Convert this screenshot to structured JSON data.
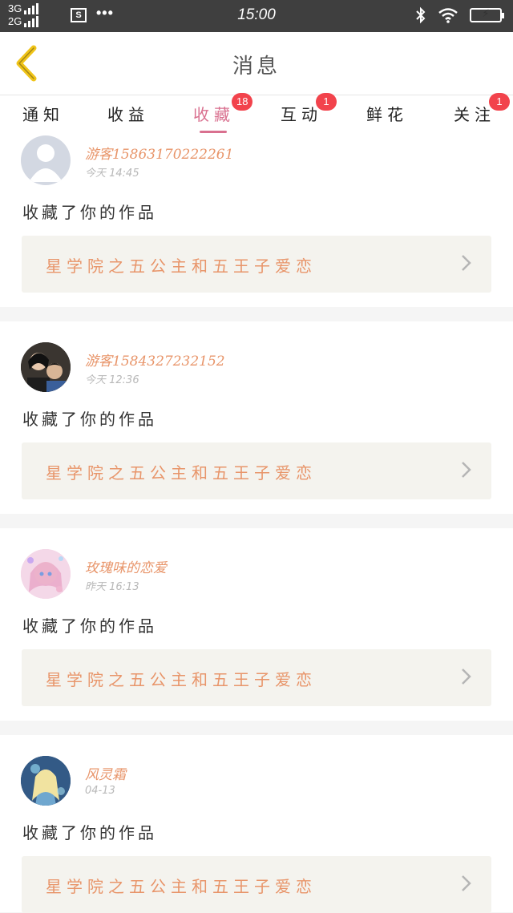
{
  "status_bar": {
    "net1": "3G",
    "net2": "2G",
    "sim": "S",
    "dots": "•••",
    "time": "15:00"
  },
  "header": {
    "title": "消息"
  },
  "tabs": [
    {
      "label": "通知",
      "badge": ""
    },
    {
      "label": "收益",
      "badge": ""
    },
    {
      "label": "收藏",
      "badge": "18"
    },
    {
      "label": "互动",
      "badge": "1"
    },
    {
      "label": "鲜花",
      "badge": ""
    },
    {
      "label": "关注",
      "badge": "1"
    }
  ],
  "active_tab": "收藏",
  "messages": [
    {
      "user": "游客15863170222261",
      "time": "今天 14:45",
      "action": "收藏了你的作品",
      "work": "星学院之五公主和五王子爱恋",
      "avatar": "default-avatar"
    },
    {
      "user": "游客1584327232152",
      "time": "今天 12:36",
      "action": "收藏了你的作品",
      "work": "星学院之五公主和五王子爱恋",
      "avatar": "photo-avatar"
    },
    {
      "user": "玫瑰味的恋爱",
      "time": "昨天 16:13",
      "action": "收藏了你的作品",
      "work": "星学院之五公主和五王子爱恋",
      "avatar": "anime-avatar-pink"
    },
    {
      "user": "风灵霜",
      "time": "04-13",
      "action": "收藏了你的作品",
      "work": "星学院之五公主和五王子爱恋",
      "avatar": "anime-avatar-blue"
    }
  ],
  "colors": {
    "accent": "#d9708f",
    "name": "#e8956a",
    "badge": "#f2434c",
    "back": "#f0c419"
  }
}
